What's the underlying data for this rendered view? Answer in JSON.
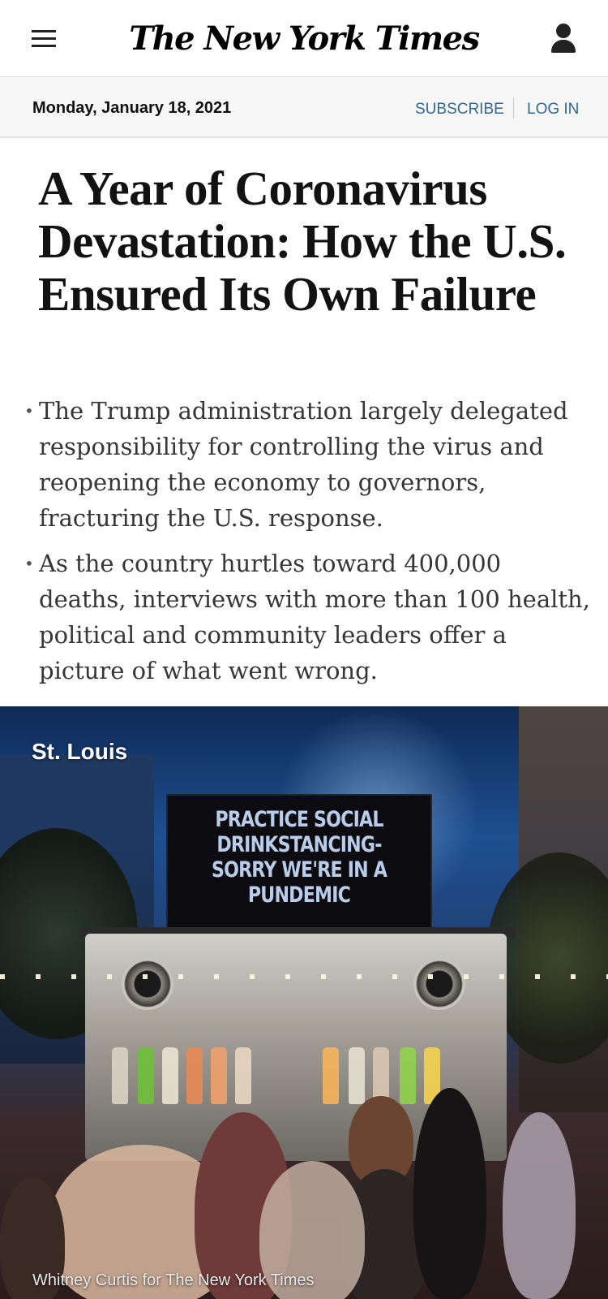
{
  "header": {
    "masthead": "The New York Times"
  },
  "datebar": {
    "date": "Monday, January 18, 2021",
    "subscribe_label": "SUBSCRIBE",
    "login_label": "LOG IN"
  },
  "article": {
    "headline": "A Year of Coronavirus Devastation: How the U.S. Ensured Its Own Failure",
    "summary": [
      "The Trump administration largely delegated responsibility for controlling the virus and reopening the economy to governors, fracturing the U.S. response.",
      "As the country hurtles toward 400,000 deaths, interviews with more than 100 health, political and community leaders offer a picture of what went wrong."
    ]
  },
  "photo": {
    "location": "St. Louis",
    "sign_text": "PRACTICE SOCIAL DRINKSTANCING- SORRY WE'RE IN A PUNDEMIC",
    "credit": "Whitney Curtis for The New York Times"
  },
  "icons": {
    "menu": "hamburger-menu-icon",
    "account": "user-account-icon"
  },
  "colors": {
    "link": "#326891",
    "datebar_bg": "#f7f7f7",
    "headline": "#121212",
    "summary": "#363636"
  }
}
